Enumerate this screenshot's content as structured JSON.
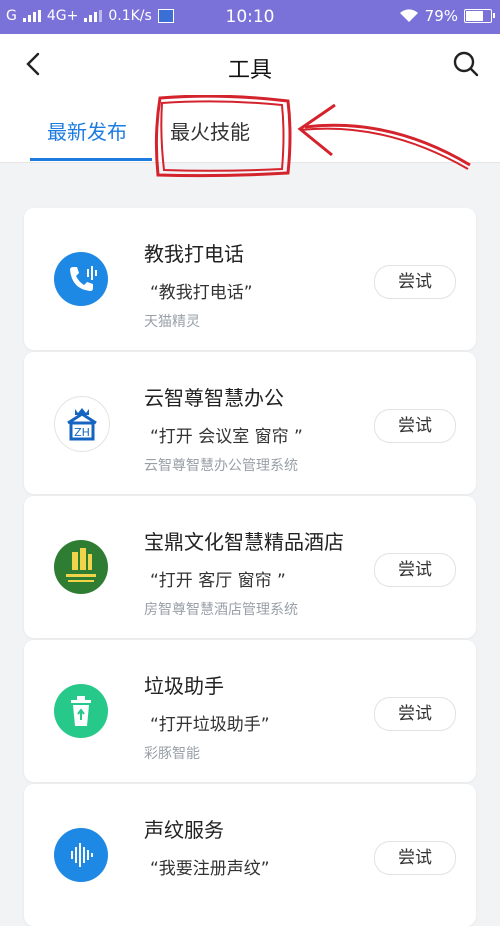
{
  "status_bar": {
    "left_text": "G",
    "network": "4G+",
    "speed": "0.1K/s",
    "time": "10:10",
    "battery": "79%",
    "battery_level": 0.79
  },
  "header": {
    "title": "工具",
    "tabs": [
      {
        "label": "最新发布",
        "active": true
      },
      {
        "label": "最火技能",
        "active": false
      }
    ]
  },
  "items": [
    {
      "name": "教我打电话",
      "command": "“教我打电话”",
      "maker": "天猫精灵",
      "try_label": "尝试",
      "icon": "phone-voice-icon",
      "icon_color": "#1e88e5"
    },
    {
      "name": "云智尊智慧办公",
      "command": "“打开 会议室  窗帘 ”",
      "maker": "云智尊智慧办公管理系统",
      "try_label": "尝试",
      "icon": "house-crown-icon",
      "icon_color": "#1565c0"
    },
    {
      "name": "宝鼎文化智慧精品酒店",
      "command": "“打开 客厅  窗帘 ”",
      "maker": "房智尊智慧酒店管理系统",
      "try_label": "尝试",
      "icon": "hotel-logo-icon",
      "icon_color": "#2e7d32"
    },
    {
      "name": "垃圾助手",
      "command": "“打开垃圾助手”",
      "maker": "彩豚智能",
      "try_label": "尝试",
      "icon": "recycle-bin-icon",
      "icon_color": "#27c98a"
    },
    {
      "name": "声纹服务",
      "command": "“我要注册声纹”",
      "maker": "",
      "try_label": "尝试",
      "icon": "voiceprint-icon",
      "icon_color": "#1e88e5"
    }
  ]
}
